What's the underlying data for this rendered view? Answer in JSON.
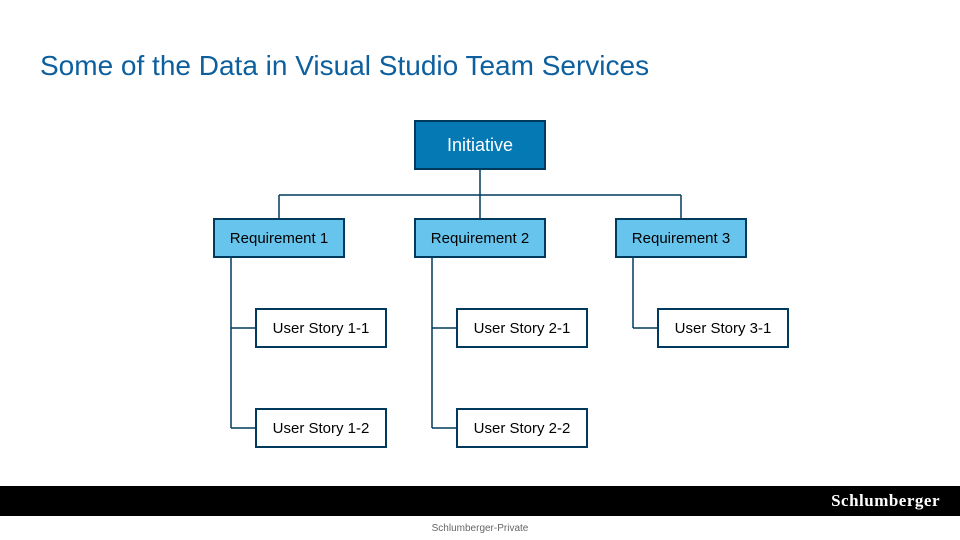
{
  "title": "Some of the Data in Visual Studio Team Services",
  "nodes": {
    "initiative": "Initiative",
    "req1": "Requirement 1",
    "req2": "Requirement 2",
    "req3": "Requirement 3",
    "us11": "User Story 1-1",
    "us12": "User Story 1-2",
    "us21": "User Story 2-1",
    "us22": "User Story 2-2",
    "us31": "User Story 3-1"
  },
  "footer": {
    "brand": "Schlumberger",
    "privacy": "Schlumberger-Private"
  },
  "colors": {
    "titleColor": "#0d5f9e",
    "initiativeFill": "#0579b4",
    "reqFill": "#66c4ed",
    "border": "#003a5d",
    "connector": "#003a5d"
  }
}
